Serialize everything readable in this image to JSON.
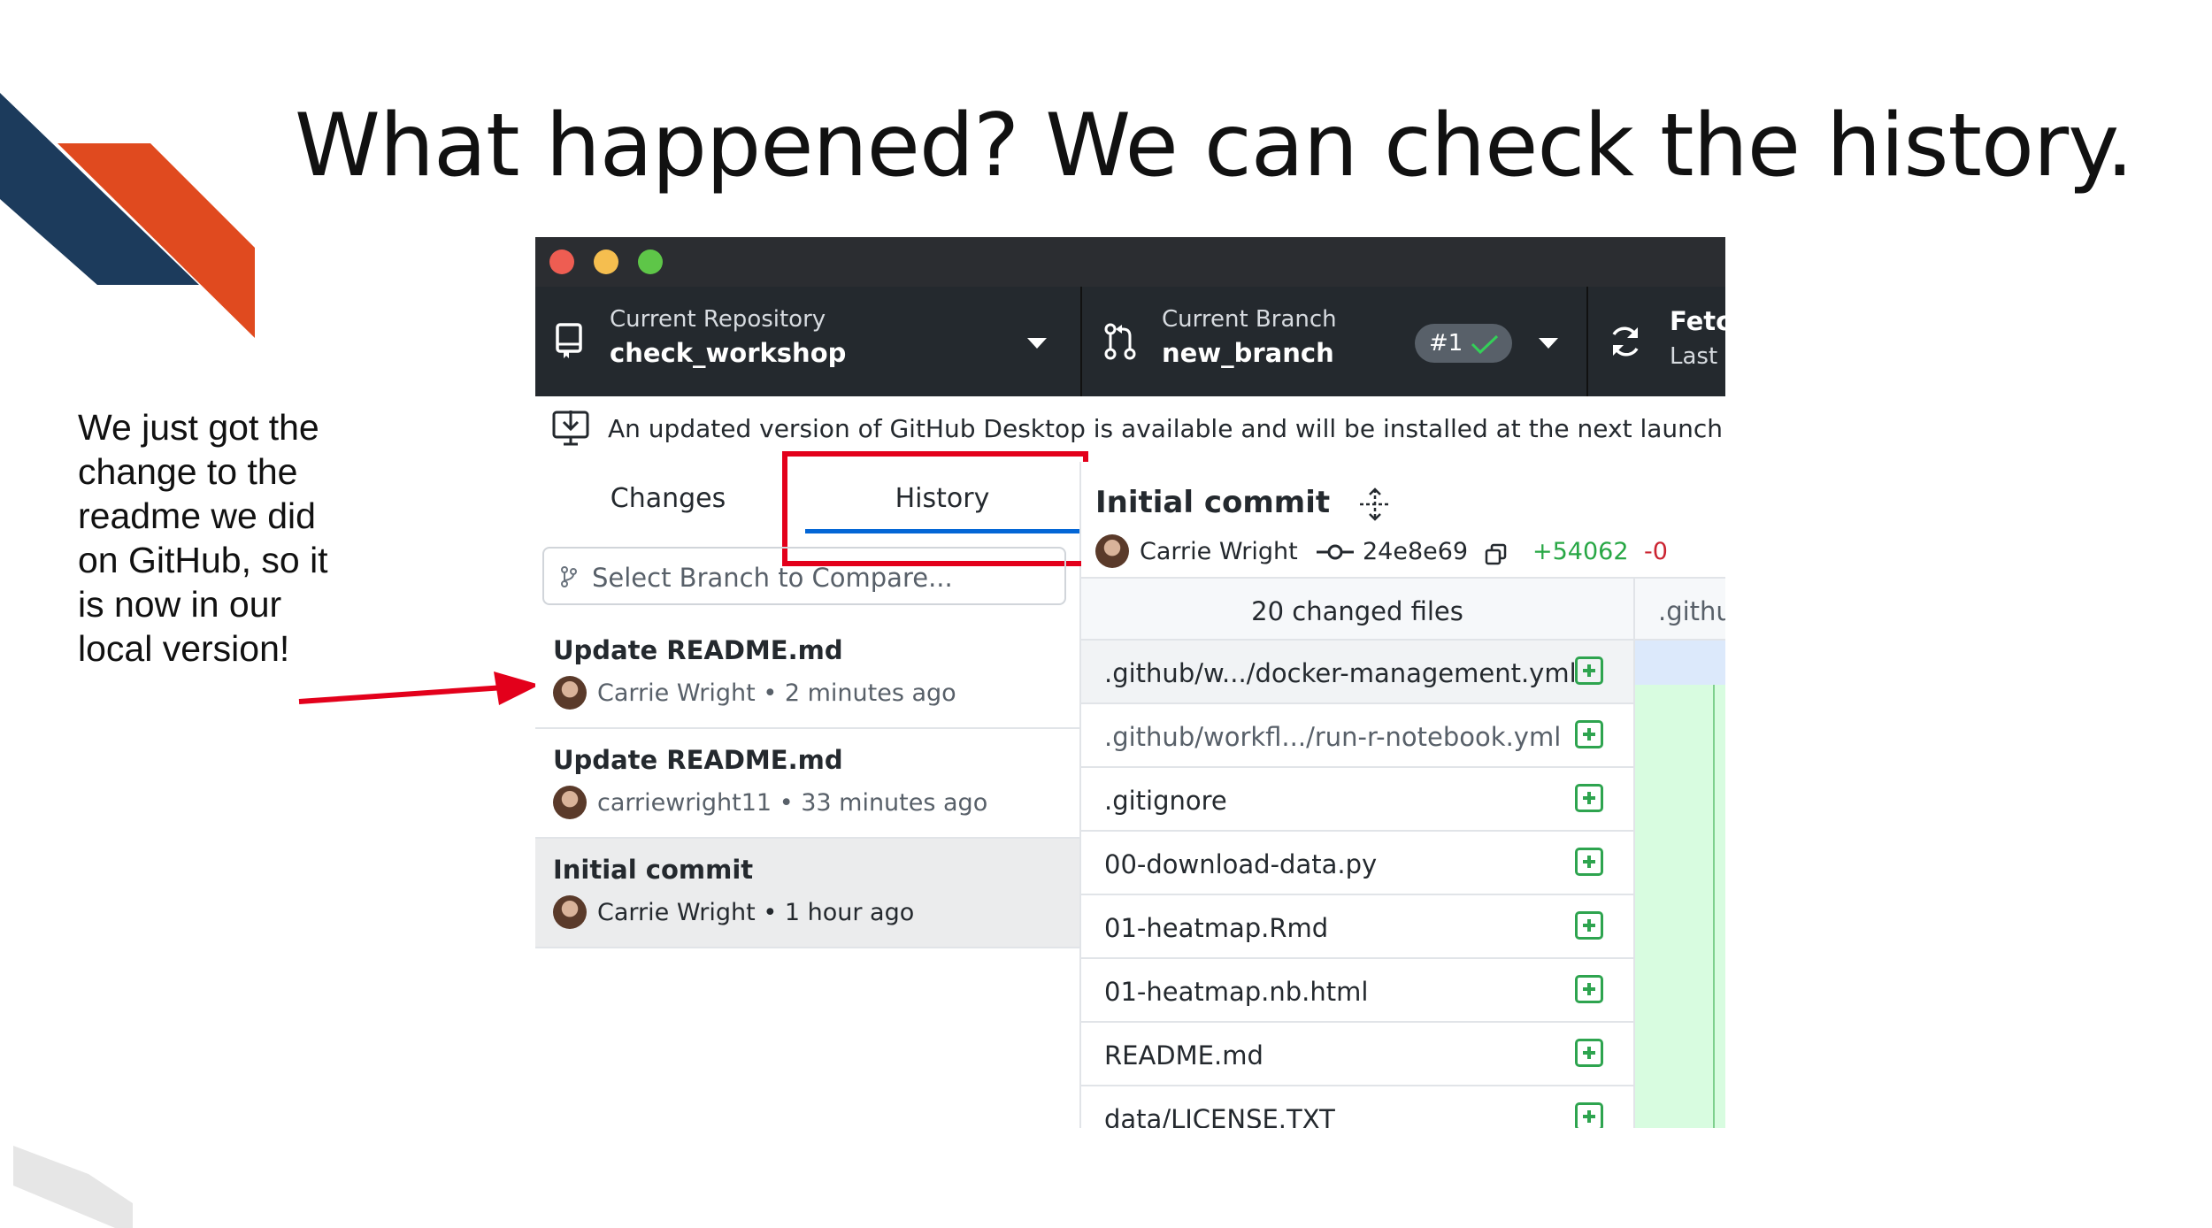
{
  "slide": {
    "title": "What happened? We can check the history.",
    "note_lines": [
      "We just got the",
      "change to the",
      "readme we did",
      "on GitHub, so it",
      "is now in our",
      "local version!"
    ]
  },
  "colors": {
    "accent_red": "#e3001b",
    "orange": "#e04a1f",
    "navy": "#1c3b5c",
    "added_green": "#2ea44f",
    "deleted_red": "#cb2431"
  },
  "toolbar": {
    "repo_caption": "Current Repository",
    "repo_name": "check_workshop",
    "branch_caption": "Current Branch",
    "branch_name": "new_branch",
    "pr_badge": "#1",
    "fetch_caption": "Fetc",
    "fetch_sub": "Last"
  },
  "banner": {
    "text": "An updated version of GitHub Desktop is available and will be installed at the next launch."
  },
  "tabs": {
    "changes": "Changes",
    "history": "History",
    "active": "History"
  },
  "compare": {
    "placeholder": "Select Branch to Compare..."
  },
  "commits": [
    {
      "title": "Update README.md",
      "author": "Carrie Wright",
      "time": "2 minutes ago"
    },
    {
      "title": "Update README.md",
      "author": "carriewright11",
      "time": "33 minutes ago"
    },
    {
      "title": "Initial commit",
      "author": "Carrie Wright",
      "time": "1 hour ago"
    }
  ],
  "selected_commit": {
    "title": "Initial commit",
    "author": "Carrie Wright",
    "sha": "24e8e69",
    "additions": "+54062",
    "deletions": "-0",
    "changed_files_label": "20 changed files",
    "diff_path_prefix": ".githu"
  },
  "files": [
    ".github/w.../docker-management.yml",
    ".github/workfl.../run-r-notebook.yml",
    ".gitignore",
    "00-download-data.py",
    "01-heatmap.Rmd",
    "01-heatmap.nb.html",
    "README.md",
    "data/LICENSE.TXT"
  ]
}
